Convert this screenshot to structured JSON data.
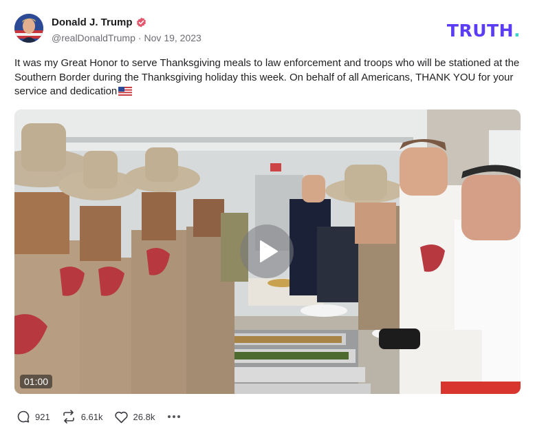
{
  "post": {
    "author_name": "Donald J. Trump",
    "handle": "@realDonaldTrump",
    "separator": "·",
    "date": "Nov 19, 2023",
    "text": "It was my Great Honor to serve Thanksgiving meals to law enforcement and troops who will be stationed at the Southern Border during the Thanksgiving holiday this week. On behalf of all Americans, THANK YOU for your service and dedication"
  },
  "brand": {
    "prefix": "TRUTH",
    "suffix": ".",
    "color": "#5a3df5",
    "dot_color": "#3fd4c9"
  },
  "icons": {
    "verified": "verified-badge-icon",
    "flag": "us-flag-emoji",
    "play": "play-icon",
    "reply": "reply-icon",
    "retruth": "retruth-icon",
    "like": "heart-icon",
    "more": "more-options-icon"
  },
  "media": {
    "duration": "01:00"
  },
  "stats": {
    "replies": "921",
    "retruths": "6.61k",
    "likes": "26.8k"
  },
  "colors": {
    "verified": "#e3566b",
    "text": "#1f1f22",
    "muted": "#6b6b73"
  }
}
